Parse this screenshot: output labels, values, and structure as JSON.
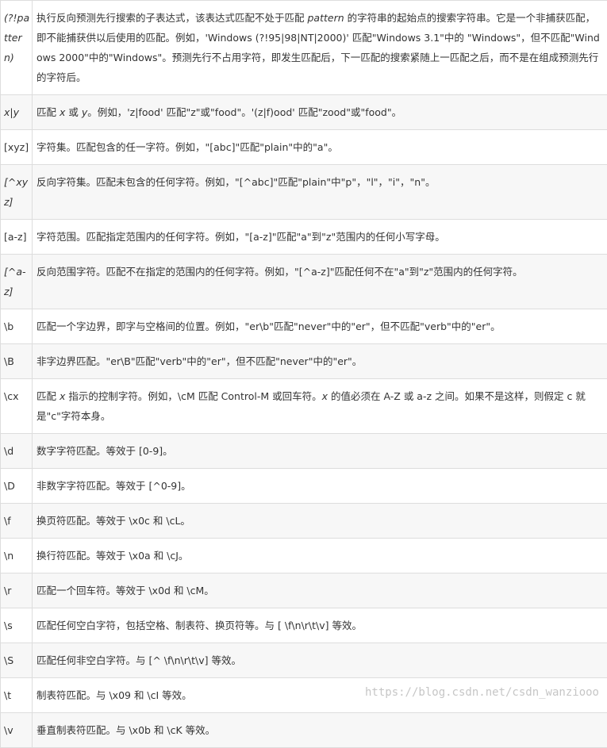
{
  "rows": [
    {
      "pattern": "(?!pattern)",
      "desc_parts": [
        {
          "t": "执行反向预测先行搜索的子表达式，该表达式匹配不处于匹配 ",
          "i": false
        },
        {
          "t": "pattern",
          "i": true
        },
        {
          "t": " 的字符串的起始点的搜索字符串。它是一个非捕获匹配，即不能捕获供以后使用的匹配。例如，'Windows (?!95|98|NT|2000)' 匹配\"Windows 3.1\"中的 \"Windows\"，但不匹配\"Windows 2000\"中的\"Windows\"。预测先行不占用字符，即发生匹配后，下一匹配的搜索紧随上一匹配之后，而不是在组成预测先行的字符后。",
          "i": false
        }
      ]
    },
    {
      "pattern": "x|y",
      "desc_parts": [
        {
          "t": "匹配 ",
          "i": false
        },
        {
          "t": "x",
          "i": true
        },
        {
          "t": " 或 ",
          "i": false
        },
        {
          "t": "y",
          "i": true
        },
        {
          "t": "。例如，'z|food' 匹配\"z\"或\"food\"。'(z|f)ood' 匹配\"zood\"或\"food\"。",
          "i": false
        }
      ]
    },
    {
      "pattern": "[xyz]",
      "desc_parts": [
        {
          "t": "字符集。匹配包含的任一字符。例如，\"[abc]\"匹配\"plain\"中的\"a\"。",
          "i": false
        }
      ]
    },
    {
      "pattern": "[^xyz]",
      "desc_parts": [
        {
          "t": "反向字符集。匹配未包含的任何字符。例如，\"[^abc]\"匹配\"plain\"中\"p\"，\"l\"，\"i\"，\"n\"。",
          "i": false
        }
      ]
    },
    {
      "pattern": "[a-z]",
      "desc_parts": [
        {
          "t": "字符范围。匹配指定范围内的任何字符。例如，\"[a-z]\"匹配\"a\"到\"z\"范围内的任何小写字母。",
          "i": false
        }
      ]
    },
    {
      "pattern": "[^a-z]",
      "desc_parts": [
        {
          "t": "反向范围字符。匹配不在指定的范围内的任何字符。例如，\"[^a-z]\"匹配任何不在\"a\"到\"z\"范围内的任何字符。",
          "i": false
        }
      ]
    },
    {
      "pattern": "\\b",
      "desc_parts": [
        {
          "t": "匹配一个字边界，即字与空格间的位置。例如，\"er\\b\"匹配\"never\"中的\"er\"，但不匹配\"verb\"中的\"er\"。",
          "i": false
        }
      ]
    },
    {
      "pattern": "\\B",
      "desc_parts": [
        {
          "t": "非字边界匹配。\"er\\B\"匹配\"verb\"中的\"er\"，但不匹配\"never\"中的\"er\"。",
          "i": false
        }
      ]
    },
    {
      "pattern": "\\cx",
      "desc_parts": [
        {
          "t": "匹配 ",
          "i": false
        },
        {
          "t": "x",
          "i": true
        },
        {
          "t": " 指示的控制字符。例如，\\cM 匹配 Control-M 或回车符。",
          "i": false
        },
        {
          "t": "x",
          "i": true
        },
        {
          "t": " 的值必须在 A-Z 或 a-z 之间。如果不是这样，则假定 c 就是\"c\"字符本身。",
          "i": false
        }
      ]
    },
    {
      "pattern": "\\d",
      "desc_parts": [
        {
          "t": "数字字符匹配。等效于 [0-9]。",
          "i": false
        }
      ]
    },
    {
      "pattern": "\\D",
      "desc_parts": [
        {
          "t": "非数字字符匹配。等效于 [^0-9]。",
          "i": false
        }
      ]
    },
    {
      "pattern": "\\f",
      "desc_parts": [
        {
          "t": "换页符匹配。等效于 \\x0c 和 \\cL。",
          "i": false
        }
      ]
    },
    {
      "pattern": "\\n",
      "desc_parts": [
        {
          "t": "换行符匹配。等效于 \\x0a 和 \\cJ。",
          "i": false
        }
      ]
    },
    {
      "pattern": "\\r",
      "desc_parts": [
        {
          "t": "匹配一个回车符。等效于 \\x0d 和 \\cM。",
          "i": false
        }
      ]
    },
    {
      "pattern": "\\s",
      "desc_parts": [
        {
          "t": "匹配任何空白字符，包括空格、制表符、换页符等。与 [ \\f\\n\\r\\t\\v] 等效。",
          "i": false
        }
      ]
    },
    {
      "pattern": "\\S",
      "desc_parts": [
        {
          "t": "匹配任何非空白字符。与 [^ \\f\\n\\r\\t\\v] 等效。",
          "i": false
        }
      ]
    },
    {
      "pattern": "\\t",
      "desc_parts": [
        {
          "t": "制表符匹配。与 \\x09 和 \\cI 等效。",
          "i": false
        }
      ]
    },
    {
      "pattern": "\\v",
      "desc_parts": [
        {
          "t": "垂直制表符匹配。与 \\x0b 和 \\cK 等效。",
          "i": false
        }
      ]
    }
  ],
  "pattern_italic_rows": [
    0,
    1,
    3,
    5
  ],
  "watermark": "https://blog.csdn.net/csdn_wanziooo"
}
